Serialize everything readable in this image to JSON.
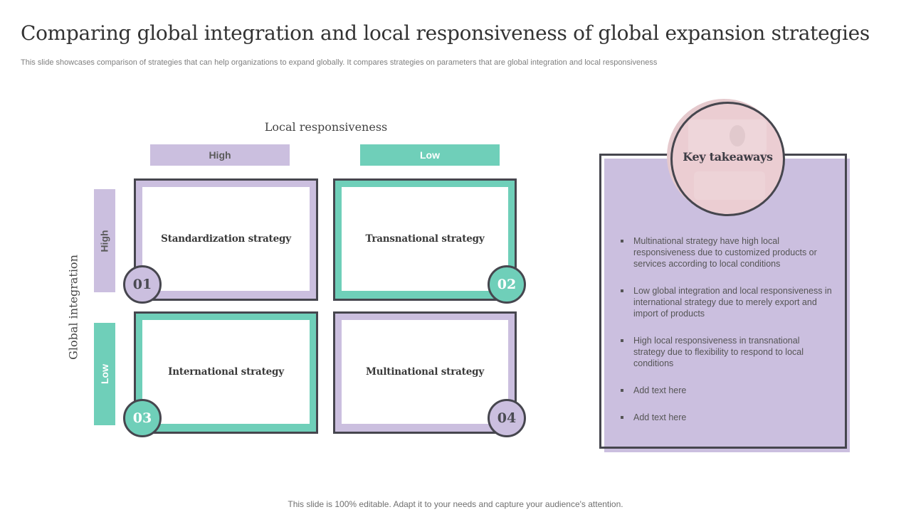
{
  "title": "Comparing global integration and local responsiveness of global expansion strategies",
  "subtitle": "This slide showcases comparison of strategies that can help organizations to expand globally. It compares strategies on parameters that are global integration and local responsiveness",
  "matrix": {
    "x_axis_title": "Local responsiveness",
    "y_axis_title": "Global integration",
    "columns": [
      {
        "label": "High",
        "color": "#cbbfdf"
      },
      {
        "label": "Low",
        "color": "#6fcfb9"
      }
    ],
    "rows": [
      {
        "label": "High",
        "color": "#cbbfdf"
      },
      {
        "label": "Low",
        "color": "#6fcfb9"
      }
    ],
    "quadrants": [
      {
        "number": "01",
        "label": "Standardization strategy",
        "color": "#cbbfdf"
      },
      {
        "number": "02",
        "label": "Transnational strategy",
        "color": "#6fcfb9"
      },
      {
        "number": "03",
        "label": "International strategy",
        "color": "#6fcfb9"
      },
      {
        "number": "04",
        "label": "Multinational strategy",
        "color": "#cbbfdf"
      }
    ]
  },
  "key_takeaways": {
    "title": "Key takeaways",
    "items": [
      "Multinational strategy have high local responsiveness  due to customized products or services according to local conditions",
      "Low global integration and local responsiveness  in international strategy due to merely export and import of products",
      "High local responsiveness  in transnational strategy due to flexibility to respond to local conditions",
      "Add text here",
      "Add text here"
    ]
  },
  "footer": "This slide is 100% editable. Adapt it to your needs and capture your audience's attention.",
  "colors": {
    "purple": "#cbbfdf",
    "teal": "#6fcfb9",
    "pink": "#ebcdd2",
    "outline": "#46464e"
  }
}
